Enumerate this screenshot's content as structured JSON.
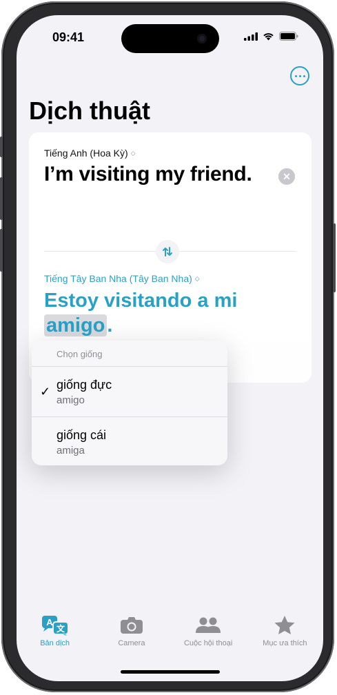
{
  "status_bar": {
    "time": "09:41"
  },
  "header": {
    "title": "Dịch thuật"
  },
  "source": {
    "language": "Tiếng Anh (Hoa Kỳ)",
    "text": "I’m visiting my friend."
  },
  "target": {
    "language": "Tiếng Tây Ban Nha (Tây Ban Nha)",
    "text_before": "Estoy visitando a mi",
    "highlighted_word": "amigo",
    "text_after": "."
  },
  "gender_menu": {
    "title": "Chọn giống",
    "options": [
      {
        "label": "giống đực",
        "example": "amigo",
        "selected": true
      },
      {
        "label": "giống cái",
        "example": "amiga",
        "selected": false
      }
    ]
  },
  "tabs": [
    {
      "label": "Bản dịch",
      "icon": "translate-icon",
      "active": true
    },
    {
      "label": "Camera",
      "icon": "camera-icon",
      "active": false
    },
    {
      "label": "Cuộc hội thoại",
      "icon": "people-icon",
      "active": false
    },
    {
      "label": "Mục ưa thích",
      "icon": "star-icon",
      "active": false
    }
  ],
  "colors": {
    "accent": "#2aa0c5",
    "background": "#f2f2f7",
    "inactive": "#8e8e93"
  }
}
